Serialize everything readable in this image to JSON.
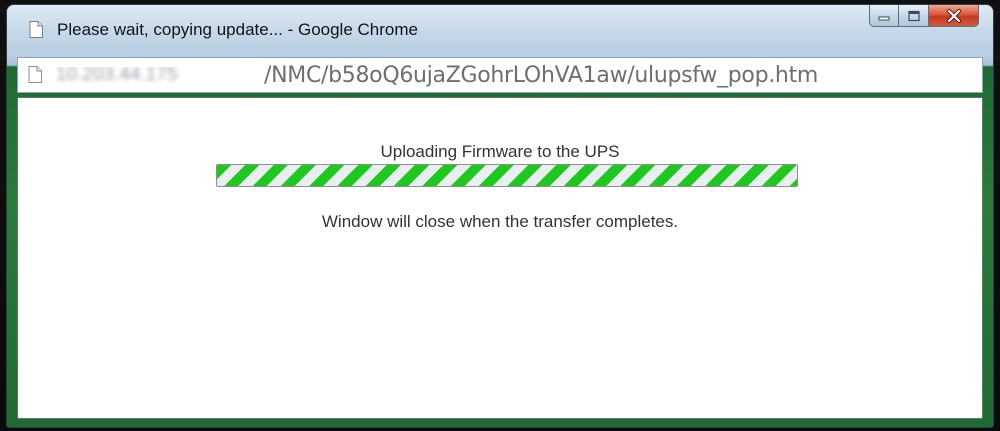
{
  "window": {
    "title": "Please wait, copying update... - Google Chrome"
  },
  "address_bar": {
    "host_redacted": "10.203.44.175",
    "path": "/NMC/b58oQ6ujaZGohrLOhVA1aw/ulupsfw_pop.htm"
  },
  "page": {
    "heading": "Uploading Firmware to the UPS",
    "progress_fraction": 1.0,
    "note": "Window will close when the transfer completes."
  },
  "icons": {
    "page": "page-icon",
    "minimize": "minimize-icon",
    "maximize": "maximize-icon",
    "close": "close-icon"
  },
  "colors": {
    "progress_stripe": "#1ec81e",
    "close_button": "#c23a20"
  }
}
